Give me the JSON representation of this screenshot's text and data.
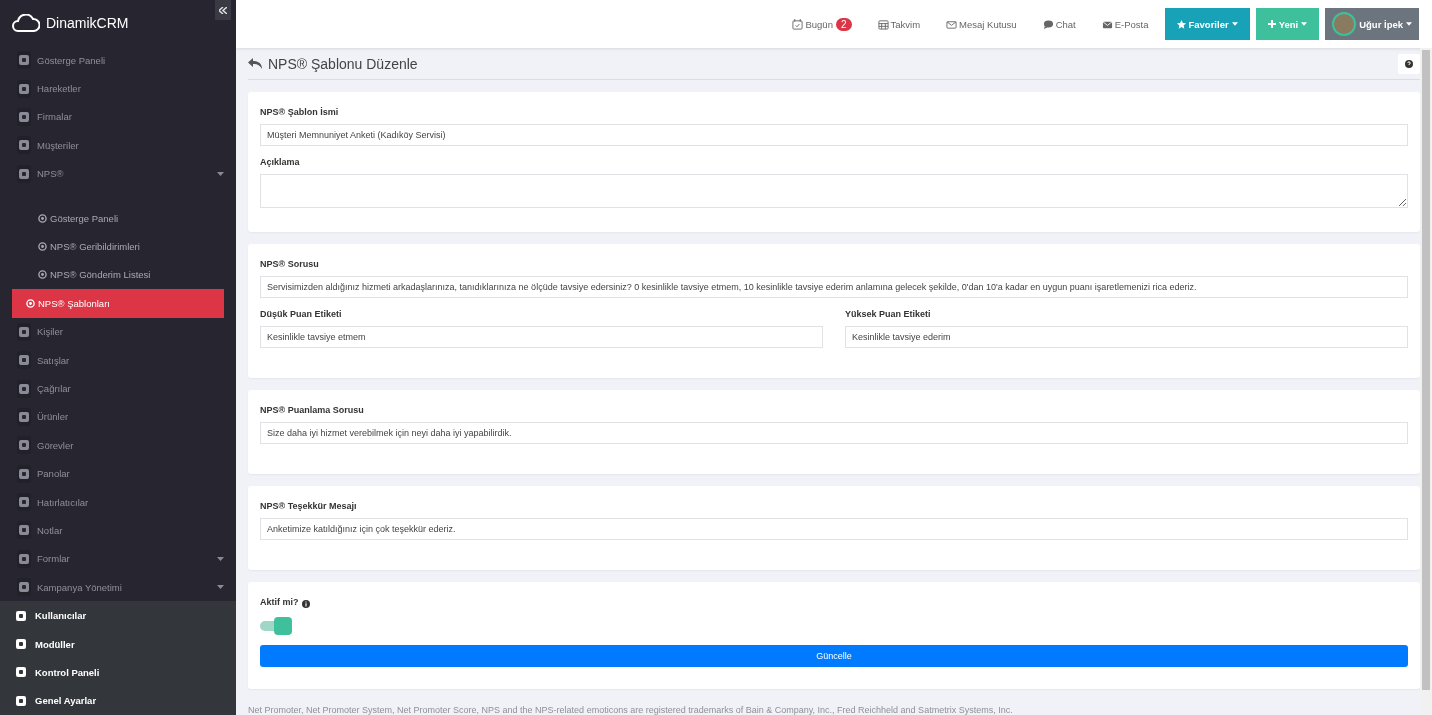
{
  "sidebar": {
    "brand": "DinamikCRM",
    "menu": [
      {
        "label": "Gösterge Paneli",
        "selected": false,
        "expandable": false
      },
      {
        "label": "Hareketler",
        "selected": false,
        "expandable": false
      },
      {
        "label": "Firmalar",
        "selected": false,
        "expandable": false
      },
      {
        "label": "Müşteriler",
        "selected": false,
        "expandable": false
      },
      {
        "label": "NPS®",
        "selected": false,
        "expandable": true,
        "expanded": true,
        "children": [
          {
            "label": "Gösterge Paneli",
            "selected": false
          },
          {
            "label": "NPS® Geribildirimleri",
            "selected": false
          },
          {
            "label": "NPS® Gönderim Listesi",
            "selected": false
          },
          {
            "label": "NPS® Şablonları",
            "selected": true
          }
        ]
      },
      {
        "label": "Kişiler",
        "selected": false,
        "expandable": false
      },
      {
        "label": "Satışlar",
        "selected": false,
        "expandable": false
      },
      {
        "label": "Çağrılar",
        "selected": false,
        "expandable": false
      },
      {
        "label": "Ürünler",
        "selected": false,
        "expandable": false
      },
      {
        "label": "Görevler",
        "selected": false,
        "expandable": false
      },
      {
        "label": "Panolar",
        "selected": false,
        "expandable": false
      },
      {
        "label": "Hatırlatıcılar",
        "selected": false,
        "expandable": false
      },
      {
        "label": "Notlar",
        "selected": false,
        "expandable": false
      },
      {
        "label": "Formlar",
        "selected": false,
        "expandable": true,
        "expanded": false
      },
      {
        "label": "Kampanya Yönetimi",
        "selected": false,
        "expandable": true,
        "expanded": false
      }
    ],
    "admin_menu": [
      "Kullanıcılar",
      "Modüller",
      "Kontrol Paneli",
      "Genel Ayarlar"
    ]
  },
  "topbar": {
    "links": [
      {
        "label": "Bugün",
        "badge": "2"
      },
      {
        "label": "Takvim"
      },
      {
        "label": "Mesaj Kutusu"
      },
      {
        "label": "Chat"
      },
      {
        "label": "E-Posta"
      }
    ],
    "buttons": [
      {
        "label": "Favoriler",
        "kind": "favorites"
      },
      {
        "label": "Yeni",
        "kind": "new"
      },
      {
        "label": "Uğur İpek",
        "kind": "user"
      }
    ]
  },
  "page": {
    "title": "NPS® Şablonu Düzenle"
  },
  "cards": [
    {
      "rows": [
        [
          {
            "label": "NPS® Şablon İsmi",
            "kind": "input",
            "value": "Müşteri Memnuniyet Anketi (Kadıköy Servisi)"
          }
        ],
        [
          {
            "label": "Açıklama",
            "kind": "textarea"
          }
        ]
      ]
    },
    {
      "rows": [
        [
          {
            "label": "NPS® Sorusu",
            "kind": "input",
            "value": "Servisimizden aldığınız hizmeti arkadaşlarınıza, tanıdıklarınıza ne ölçüde tavsiye edersiniz? 0 kesinlikle tavsiye etmem, 10 kesinlikle tavsiye ederim anlamına gelecek şekilde, 0'dan 10'a kadar en uygun puanı işaretlemenizi rica ederiz."
          }
        ],
        [
          {
            "label": "Düşük Puan Etiketi",
            "kind": "input",
            "value": "Kesinlikle tavsiye etmem"
          },
          {
            "label": "Yüksek Puan Etiketi",
            "kind": "input",
            "value": "Kesinlikle tavsiye ederim"
          }
        ]
      ]
    },
    {
      "rows": [
        [
          {
            "label": "NPS® Puanlama Sorusu",
            "kind": "input",
            "value": "Size daha iyi hizmet verebilmek için neyi daha iyi yapabilirdik."
          }
        ]
      ]
    },
    {
      "rows": [
        [
          {
            "label": "NPS® Teşekkür Mesajı",
            "kind": "input",
            "value": "Anketimize katıldığınız için çok teşekkür ederiz."
          }
        ]
      ]
    }
  ],
  "status_card": {
    "label": "Aktif mi?",
    "on": true,
    "submit": "Güncelle"
  },
  "footer": "Net Promoter, Net Promoter System, Net Promoter Score, NPS and the NPS-related emoticons are registered trademarks of Bain & Company, Inc., Fred Reichheld and Satmetrix Systems, Inc."
}
